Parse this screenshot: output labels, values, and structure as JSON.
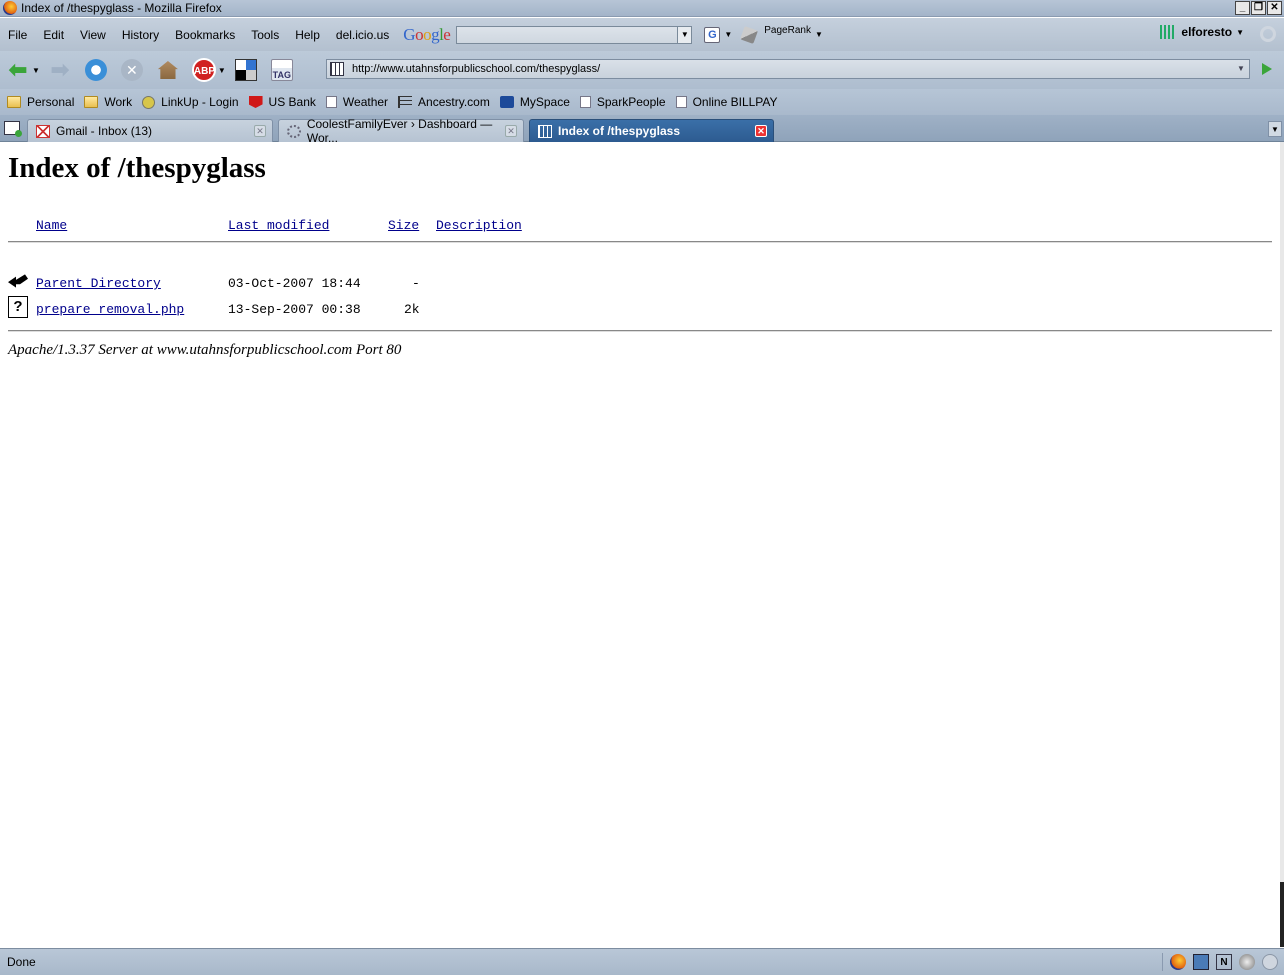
{
  "window": {
    "title": "Index of /thespyglass - Mozilla Firefox"
  },
  "menu": {
    "items": [
      {
        "label": "File"
      },
      {
        "label": "Edit"
      },
      {
        "label": "View"
      },
      {
        "label": "History"
      },
      {
        "label": "Bookmarks"
      },
      {
        "label": "Tools"
      },
      {
        "label": "Help"
      },
      {
        "label": "del.icio.us"
      }
    ],
    "google_logo": "Google",
    "pagerank_label": "PageRank",
    "user_label": "elforesto"
  },
  "navigation": {
    "url": "http://www.utahnsforpublicschool.com/thespyglass/",
    "tag_label": "TAG",
    "abp_label": "ABP"
  },
  "bookmarks": [
    {
      "label": "Personal",
      "icon": "folder-icon"
    },
    {
      "label": "Work",
      "icon": "folder-icon"
    },
    {
      "label": "LinkUp - Login",
      "icon": "linkup-icon"
    },
    {
      "label": "US Bank",
      "icon": "usbank-icon"
    },
    {
      "label": "Weather",
      "icon": "page-icon"
    },
    {
      "label": "Ancestry.com",
      "icon": "ancestry-icon"
    },
    {
      "label": "MySpace",
      "icon": "myspace-icon"
    },
    {
      "label": "SparkPeople",
      "icon": "page-icon"
    },
    {
      "label": "Online BILLPAY",
      "icon": "page-icon"
    }
  ],
  "tabs": [
    {
      "label": "Gmail - Inbox (13)",
      "active": false
    },
    {
      "label": "CoolestFamilyEver › Dashboard — Wor...",
      "active": false
    },
    {
      "label": "Index of /thespyglass",
      "active": true
    }
  ],
  "page": {
    "heading": "Index of /thespyglass",
    "columns": {
      "name": "Name",
      "last_modified": "Last modified",
      "size": "Size",
      "description": "Description"
    },
    "rows": [
      {
        "name": "Parent Directory",
        "modified": "03-Oct-2007 18:44",
        "size": "-",
        "icon": "back-icon"
      },
      {
        "name": "prepare removal.php",
        "modified": "13-Sep-2007 00:38",
        "size": "2k",
        "icon": "unknown-file-icon"
      }
    ],
    "address": "Apache/1.3.37 Server at www.utahnsforpublicschool.com Port 80"
  },
  "status": {
    "text": "Done"
  },
  "colors": {
    "link": "#00008b",
    "active_tab": "#2d5b90",
    "chrome": "#aebdcf"
  }
}
